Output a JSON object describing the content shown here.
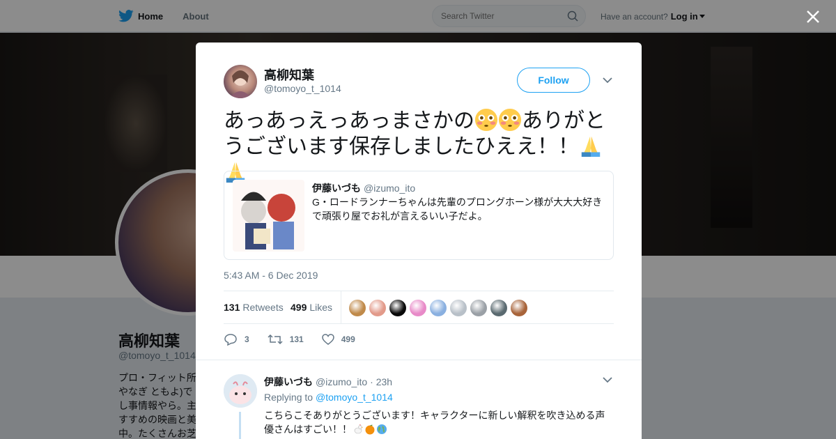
{
  "nav": {
    "home_label": "Home",
    "about_label": "About",
    "search_placeholder": "Search Twitter",
    "account_prompt": "Have an account?",
    "login_label": "Log in"
  },
  "background_profile": {
    "name": "高柳知葉",
    "handle": "@tomoyo_t_1014",
    "bio_lines": [
      "プロ・フィット所",
      "やなぎ ともよ)で",
      "し事情報やら。主",
      "すすめの映画と美",
      "中。たくさんお芝"
    ]
  },
  "tweet": {
    "author_name": "高柳知葉",
    "author_handle": "@tomoyo_t_1014",
    "follow_label": "Follow",
    "text_part1": "あっあっえっあっまさかの",
    "text_part2": "ありがとうございます保存しましたひええ！！",
    "quote": {
      "name": "伊藤いづも",
      "handle": "@izumo_ito",
      "text": "G・ロードランナーちゃんは先輩のプロングホーン様が大大大好きで頑張り屋でお礼が言えるいい子だよ。"
    },
    "timestamp": "5:43 AM - 6 Dec 2019",
    "retweets_count": "131",
    "retweets_label": "Retweets",
    "likes_count": "499",
    "likes_label": "Likes",
    "actions": {
      "replies": "3",
      "retweets": "131",
      "likes": "499"
    }
  },
  "reply": {
    "name": "伊藤いづも",
    "handle": "@izumo_ito",
    "time": "· 23h",
    "replying_prefix": "Replying to",
    "replying_to": "@tomoyo_t_1014",
    "text": "こちらこそありがとうございます！キャラクターに新しい解釈を吹き込める声優さんはすごい！！"
  },
  "colors": {
    "accent": "#1da1f2",
    "text": "#14171a",
    "muted": "#657786"
  },
  "liker_colors": [
    "#c08a4a",
    "#e29a8a",
    "#0a0a0a",
    "#e88ac8",
    "#8ab0e0",
    "#b8c0c8",
    "#9aa0a6",
    "#5a6a70",
    "#a8643a"
  ]
}
